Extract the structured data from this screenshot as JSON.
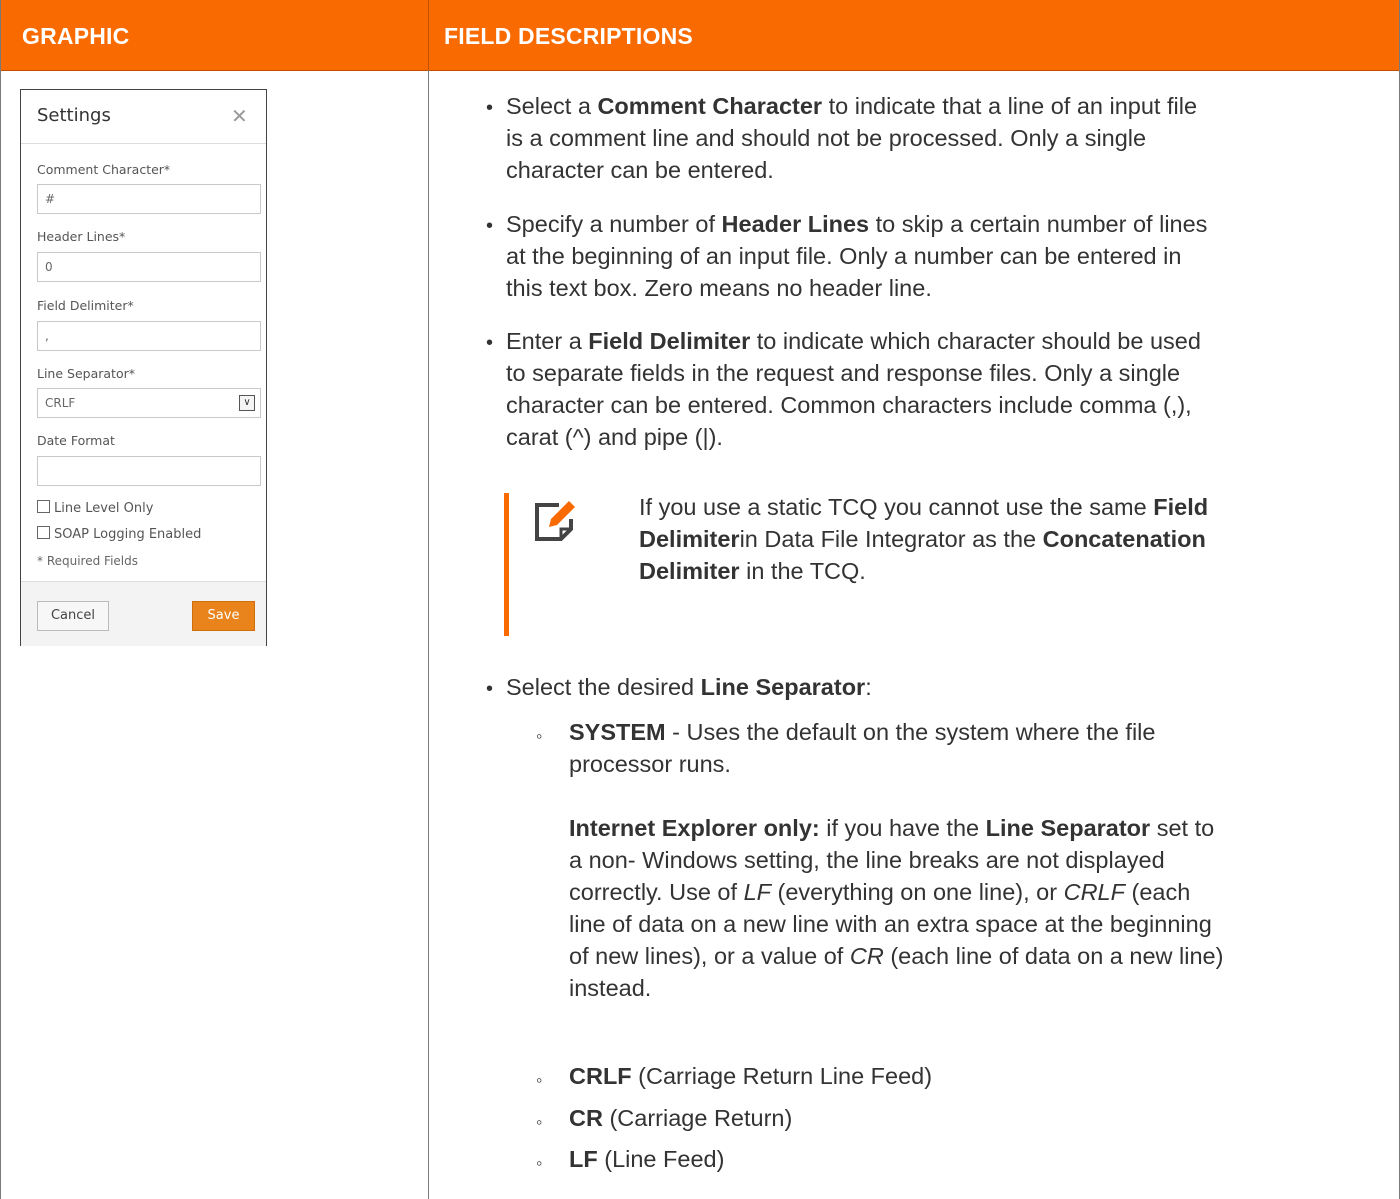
{
  "table": {
    "header_graphic": "GRAPHIC",
    "header_fields": "FIELD DESCRIPTIONS"
  },
  "dialog": {
    "title": "Settings",
    "close_glyph": "✕",
    "comment_label": "Comment Character*",
    "comment_value": "#",
    "header_label": "Header Lines*",
    "header_value": "0",
    "delimiter_label": "Field Delimiter*",
    "delimiter_value": ",",
    "separator_label": "Line Separator*",
    "separator_value": "CRLF",
    "date_label": "Date Format",
    "date_value": "",
    "line_level_label": "Line Level Only",
    "soap_label": "SOAP Logging Enabled",
    "required_note": "* Required Fields",
    "cancel_label": "Cancel",
    "save_label": "Save"
  },
  "desc": {
    "c1": "Select a ",
    "c2": "Comment Character",
    "c3": " to indicate that a line of an input file",
    "c4": "is a comment line and should not be processed. Only a single",
    "c5": "character can be entered.",
    "h1": "Specify a number of ",
    "h2": "Header Lines",
    "h3": " to skip a certain number of lines",
    "h4": "at the beginning of an input file. Only a number can be entered in",
    "h5": "this text box. Zero means no header line.",
    "d1": "Enter a ",
    "d2": "Field Delimiter",
    "d3": " to indicate which character should be used",
    "d4": "to separate fields in the request and response files. Only a single",
    "d5": "character can be entered. Common characters include comma (,),",
    "d6": "carat (^) and pipe (|).",
    "n1": "If you use a static TCQ you cannot use the same ",
    "n2": "Field",
    "n3": "Delimiter",
    "n4": "in Data File Integrator as the ",
    "n5": "Concatenation",
    "n6": "Delimiter",
    "n7": " in the TCQ.",
    "s1": "Select the desired ",
    "s2": "Line Separator",
    "s3": ":",
    "sys1": "SYSTEM",
    "sys2": " - Uses the default on the system where the file",
    "sys3": "processor runs.",
    "ie1": "Internet Explorer only:",
    "ie2": " if you have the ",
    "ie3": "Line Separator",
    "ie4": " set to",
    "ie5": "a non- Windows setting, the line breaks are not displayed",
    "ie6": "correctly. Use of ",
    "ie7": "LF",
    "ie8": " (everything on one line), or ",
    "ie9": "CRLF",
    "ie10": " (each",
    "ie11": "line of data on a new line with an extra space at the beginning",
    "ie12": "of new lines), or a value of ",
    "ie13": "CR",
    "ie14": " (each line of data on a new line)",
    "ie15": "instead.",
    "crlf1": "CRLF",
    "crlf2": " (Carriage Return Line Feed)",
    "cr1": "CR",
    "cr2": " (Carriage Return)",
    "lf1": "LF",
    "lf2": " (Line Feed)"
  }
}
